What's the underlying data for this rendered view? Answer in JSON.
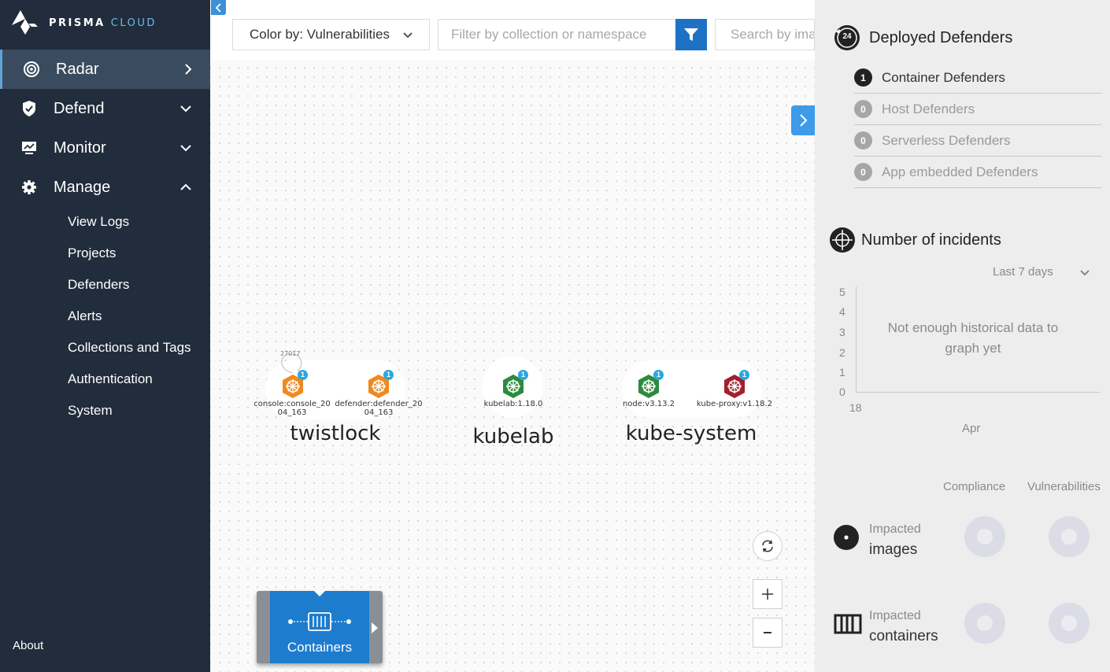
{
  "brand": {
    "name_bold": "PRISMA",
    "name_light": "CLOUD"
  },
  "sidebar": {
    "items": [
      {
        "label": "Radar",
        "icon": "radar-icon"
      },
      {
        "label": "Defend",
        "icon": "shield-icon"
      },
      {
        "label": "Monitor",
        "icon": "monitor-icon"
      },
      {
        "label": "Manage",
        "icon": "gear-icon"
      }
    ],
    "manage_sub": [
      "View Logs",
      "Projects",
      "Defenders",
      "Alerts",
      "Collections and Tags",
      "Authentication",
      "System"
    ],
    "about": "About"
  },
  "toolbar": {
    "color_by": "Color by: Vulnerabilities",
    "filter_placeholder": "Filter by collection or namespace",
    "search_placeholder": "Search by image"
  },
  "namespaces": [
    {
      "name": "twistlock",
      "nodes": [
        {
          "label_line1": "console:console_20",
          "label_line2": "04_163",
          "badge": "1",
          "color": "#ef8a1f",
          "extra": "27017"
        },
        {
          "label_line1": "defender:defender_20",
          "label_line2": "04_163",
          "badge": "1",
          "color": "#ef8a1f"
        }
      ]
    },
    {
      "name": "kubelab",
      "nodes": [
        {
          "label_line1": "kubelab:1.18.0",
          "badge": "1",
          "color": "#2e8a3e"
        }
      ]
    },
    {
      "name": "kube-system",
      "nodes": [
        {
          "label_line1": "node:v3.13.2",
          "badge": "1",
          "color": "#2e8a3e"
        },
        {
          "label_line1": "kube-proxy:v1.18.2",
          "badge": "1",
          "color": "#a0202c"
        }
      ]
    }
  ],
  "view_card": {
    "label": "Containers"
  },
  "panel": {
    "defenders": {
      "title": "Deployed Defenders",
      "badge": "24",
      "rows": [
        {
          "count": "1",
          "label": "Container Defenders"
        },
        {
          "count": "0",
          "label": "Host Defenders"
        },
        {
          "count": "0",
          "label": "Serverless Defenders"
        },
        {
          "count": "0",
          "label": "App embedded Defenders"
        }
      ]
    },
    "incidents": {
      "title": "Number of incidents",
      "range": "Last 7 days",
      "y_ticks": [
        "5",
        "4",
        "3",
        "2",
        "1",
        "0"
      ],
      "x_tick_day": "18",
      "x_tick_month": "Apr",
      "empty_line1": "Not enough historical data to",
      "empty_line2": "graph yet"
    },
    "impacted": {
      "col1": "Compliance",
      "col2": "Vulnerabilities",
      "rows": [
        {
          "line1": "Impacted",
          "line2": "images",
          "icon": "image-dot-icon"
        },
        {
          "line1": "Impacted",
          "line2": "containers",
          "icon": "container-bars-icon"
        }
      ]
    }
  }
}
